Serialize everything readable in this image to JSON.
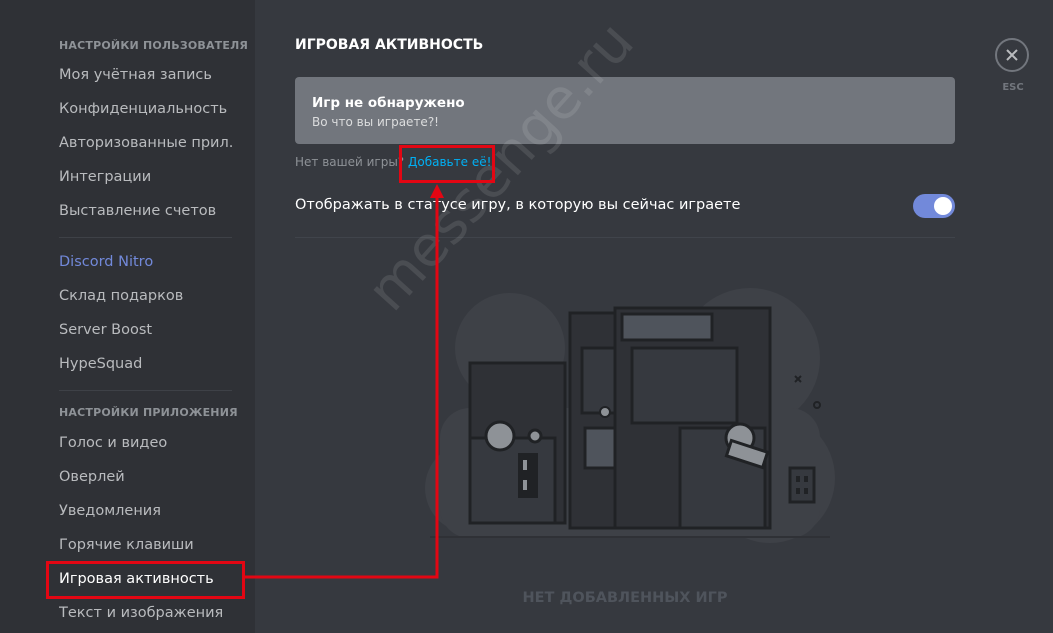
{
  "sidebar": {
    "user_settings_header": "НАСТРОЙКИ ПОЛЬЗОВАТЕЛЯ",
    "user_items": [
      {
        "label": "Моя учётная запись"
      },
      {
        "label": "Конфиденциальность"
      },
      {
        "label": "Авторизованные прил..."
      },
      {
        "label": "Интеграции"
      },
      {
        "label": "Выставление счетов"
      }
    ],
    "nitro_items": [
      {
        "label": "Discord Nitro"
      },
      {
        "label": "Склад подарков"
      },
      {
        "label": "Server Boost"
      },
      {
        "label": "HypeSquad"
      }
    ],
    "app_settings_header": "НАСТРОЙКИ ПРИЛОЖЕНИЯ",
    "app_items": [
      {
        "label": "Голос и видео"
      },
      {
        "label": "Оверлей"
      },
      {
        "label": "Уведомления"
      },
      {
        "label": "Горячие клавиши"
      },
      {
        "label": "Игровая активность",
        "selected": true
      },
      {
        "label": "Текст и изображения"
      }
    ]
  },
  "main": {
    "title": "ИГРОВАЯ АКТИВНОСТЬ",
    "game_box": {
      "title": "Игр не обнаружено",
      "subtitle": "Во что вы играете?!"
    },
    "no_game_prefix": "Нет вашей игры?",
    "add_game_link": "Добавьте её!",
    "status_toggle_label": "Отображать в статусе игру, в которую вы сейчас играете",
    "status_toggle_on": true,
    "empty_state": "НЕТ ДОБАВЛЕННЫХ ИГР"
  },
  "close": {
    "esc_label": "ESC"
  },
  "watermark": "messenge.ru",
  "colors": {
    "accent": "#7289da",
    "link": "#00b0f4",
    "highlight": "#e30613"
  }
}
